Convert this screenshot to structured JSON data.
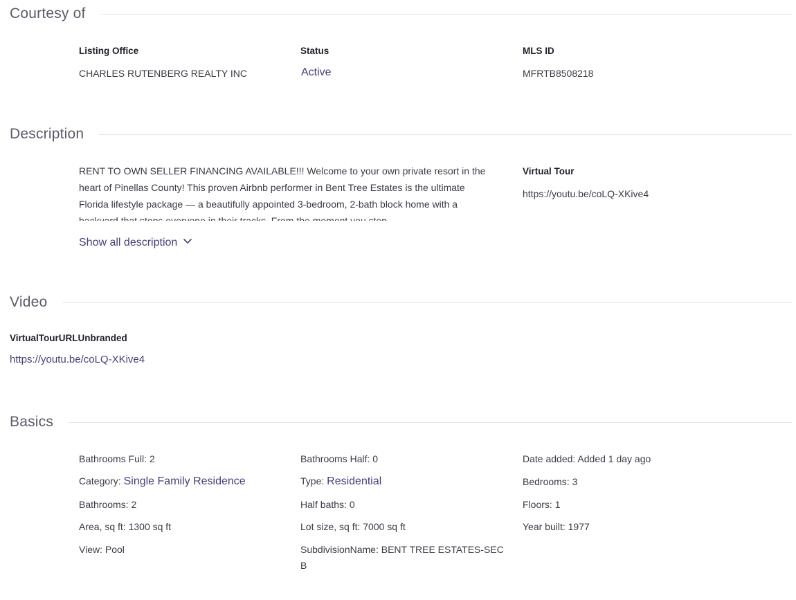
{
  "courtesy": {
    "title": "Courtesy of",
    "listing_office_label": "Listing Office",
    "listing_office_value": "CHARLES RUTENBERG REALTY INC",
    "status_label": "Status",
    "status_value": "Active",
    "mls_label": "MLS ID",
    "mls_value": "MFRTB8508218"
  },
  "description": {
    "title": "Description",
    "text": "RENT TO OWN SELLER FINANCING AVAILABLE!!! Welcome to your own private resort in the heart of Pinellas County! This proven Airbnb performer in Bent Tree Estates is the ultimate Florida lifestyle package — a beautifully appointed 3-bedroom, 2-bath block home with a backyard that stops everyone in their tracks. From the moment you step",
    "show_all": "Show all description",
    "virtual_tour_label": "Virtual Tour",
    "virtual_tour_value": "https://youtu.be/coLQ-XKive4"
  },
  "video": {
    "title": "Video",
    "label": "VirtualTourURLUnbranded",
    "link": "https://youtu.be/coLQ-XKive4"
  },
  "basics": {
    "title": "Basics",
    "col1": [
      {
        "label": "Bathrooms Full:",
        "value": "2"
      },
      {
        "label": "Category:",
        "value": "Single Family Residence"
      },
      {
        "label": "Bathrooms:",
        "value": "2"
      },
      {
        "label": "Area, sq ft:",
        "value": "1300 sq ft"
      },
      {
        "label": "View:",
        "value": "Pool"
      }
    ],
    "col2": [
      {
        "label": "Bathrooms Half:",
        "value": "0"
      },
      {
        "label": "Type:",
        "value": "Residential"
      },
      {
        "label": "Half baths:",
        "value": "0"
      },
      {
        "label": "Lot size, sq ft:",
        "value": "7000 sq ft"
      },
      {
        "label": "SubdivisionName:",
        "value": "BENT TREE ESTATES-SEC B"
      }
    ],
    "col3": [
      {
        "label": "Date added:",
        "value": "Added 1 day ago"
      },
      {
        "label": "Bedrooms:",
        "value": "3"
      },
      {
        "label": "Floors:",
        "value": "1"
      },
      {
        "label": "Year built:",
        "value": "1977"
      }
    ]
  }
}
